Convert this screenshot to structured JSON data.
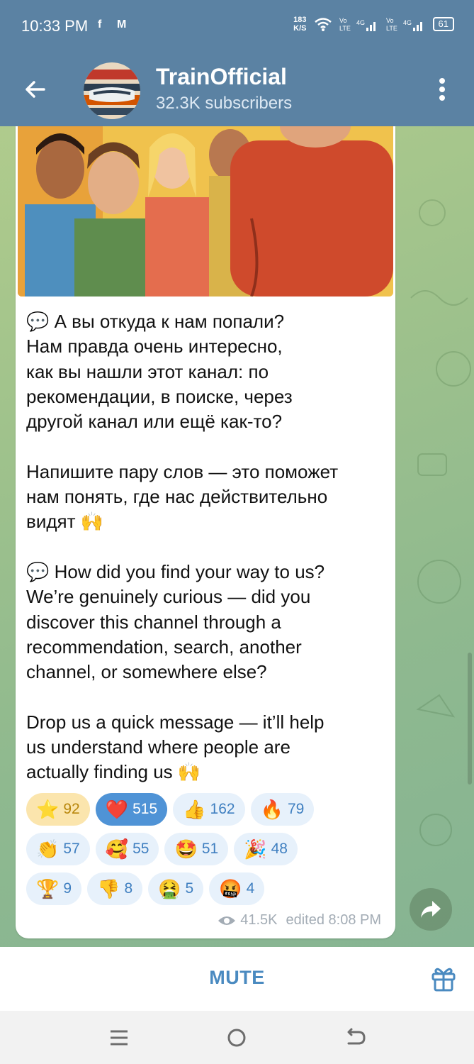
{
  "status_bar": {
    "time": "10:33 PM",
    "notif_icons": [
      "facebook-icon",
      "gmail-icon"
    ],
    "net_speed": "183",
    "net_unit": "K/S",
    "battery": "61"
  },
  "header": {
    "title": "TrainOfficial",
    "subscribers": "32.3K subscribers"
  },
  "post": {
    "text": "💬 А вы откуда к нам попали?\nНам правда очень интересно,\nкак вы нашли этот канал: по\nрекомендации, в поиске, через\nдругой канал или ещё как-то?\n\nНапишите пару слов — это поможет\nнам понять, где нас действительно\nвидят 🙌\n\n💬 How did you find your way to us?\nWe’re genuinely curious — did you\ndiscover this channel through a\nrecommendation, search, another\nchannel, or somewhere else?\n\nDrop us a quick message — it’ll help\nus understand where people are\nactually finding us 🙌",
    "views": "41.5K",
    "edited": "edited 8:08 PM"
  },
  "reactions": [
    [
      {
        "emoji": "⭐",
        "count": "92",
        "style": "gold"
      },
      {
        "emoji": "❤️",
        "count": "515",
        "style": "sel"
      },
      {
        "emoji": "👍",
        "count": "162",
        "style": ""
      },
      {
        "emoji": "🔥",
        "count": "79",
        "style": ""
      }
    ],
    [
      {
        "emoji": "👏",
        "count": "57",
        "style": ""
      },
      {
        "emoji": "🥰",
        "count": "55",
        "style": ""
      },
      {
        "emoji": "🤩",
        "count": "51",
        "style": ""
      },
      {
        "emoji": "🎉",
        "count": "48",
        "style": ""
      }
    ],
    [
      {
        "emoji": "🏆",
        "count": "9",
        "style": ""
      },
      {
        "emoji": "👎",
        "count": "8",
        "style": ""
      },
      {
        "emoji": "🤮",
        "count": "5",
        "style": ""
      },
      {
        "emoji": "🤬",
        "count": "4",
        "style": ""
      }
    ]
  ],
  "bottom_bar": {
    "mute_label": "MUTE"
  },
  "colors": {
    "header": "#5b82a3",
    "accent": "#4a8ac0",
    "selected_reaction": "#4f93d6"
  }
}
